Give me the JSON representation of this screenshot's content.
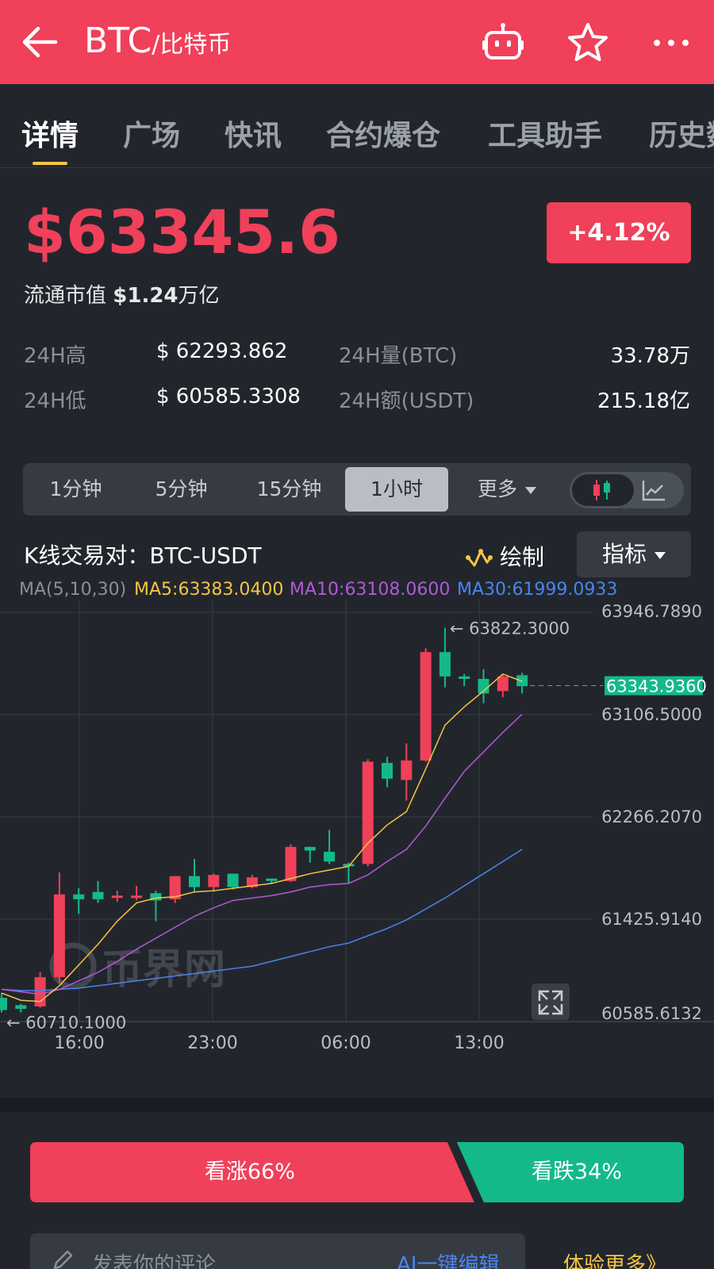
{
  "header": {
    "title_main": "BTC",
    "title_sub": "/比特币",
    "back_icon": "arrow-left-icon",
    "robot_icon": "robot-icon",
    "star_icon": "star-icon",
    "more_icon": "more-dots-icon",
    "bg_color": "#f0405a"
  },
  "tabs": [
    {
      "label": "详情",
      "active": true
    },
    {
      "label": "广场"
    },
    {
      "label": "快讯"
    },
    {
      "label": "合约爆仓"
    },
    {
      "label": "工具助手"
    },
    {
      "label": "历史数"
    }
  ],
  "price": {
    "value": "$63345.6",
    "change": "+4.12%",
    "market_cap_label": "流通市值",
    "market_cap_value": "$1.24",
    "market_cap_unit": "万亿"
  },
  "stats": {
    "high_label": "24H高",
    "high_value": "$ 62293.862",
    "low_label": "24H低",
    "low_value": "$ 60585.3308",
    "vol_label": "24H量(BTC)",
    "vol_value": "33.78万",
    "amt_label": "24H额(USDT)",
    "amt_value": "215.18亿"
  },
  "periods": [
    {
      "label": "1分钟"
    },
    {
      "label": "5分钟"
    },
    {
      "label": "15分钟"
    },
    {
      "label": "1小时",
      "active": true
    },
    {
      "label": "更多"
    }
  ],
  "toolbar": {
    "pair_label": "K线交易对：BTC-USDT",
    "draw_label": "绘制",
    "indicator_label": "指标"
  },
  "ma": {
    "label": "MA(5,10,30)",
    "ma5": "MA5:63383.0400",
    "ma10": "MA10:63108.0600",
    "ma30": "MA30:61999.0933",
    "colors": {
      "ma5": "#f5c443",
      "ma10": "#b05ad6",
      "ma30": "#4a84ef"
    }
  },
  "colors": {
    "up": "#f0405a",
    "down": "#14b98a"
  },
  "chart_data": {
    "type": "candlestick",
    "y_ticks": [
      "63946.7890",
      "63106.5000",
      "62266.2070",
      "61425.9140",
      "60585.6132"
    ],
    "ylim": [
      60585.6132,
      63946.789
    ],
    "x_ticks": [
      "16:00",
      "23:00",
      "06:00",
      "13:00"
    ],
    "current_price_label": "63343.9360",
    "current_price": 63343.936,
    "high_annotation": "← 63822.3000",
    "low_annotation": "← 60710.1000",
    "watermark": "币界网",
    "candles": [
      {
        "o": 60780,
        "h": 60820,
        "l": 60660,
        "c": 60680
      },
      {
        "o": 60720,
        "h": 60730,
        "l": 60660,
        "c": 60690
      },
      {
        "o": 60710,
        "h": 60990,
        "l": 60700,
        "c": 60950
      },
      {
        "o": 60950,
        "h": 61810,
        "l": 60900,
        "c": 61630
      },
      {
        "o": 61630,
        "h": 61680,
        "l": 61470,
        "c": 61590
      },
      {
        "o": 61650,
        "h": 61740,
        "l": 61560,
        "c": 61590
      },
      {
        "o": 61610,
        "h": 61660,
        "l": 61570,
        "c": 61620
      },
      {
        "o": 61610,
        "h": 61700,
        "l": 61580,
        "c": 61620
      },
      {
        "o": 61640,
        "h": 61660,
        "l": 61410,
        "c": 61580
      },
      {
        "o": 61590,
        "h": 61780,
        "l": 61560,
        "c": 61780
      },
      {
        "o": 61780,
        "h": 61920,
        "l": 61650,
        "c": 61690
      },
      {
        "o": 61690,
        "h": 61800,
        "l": 61650,
        "c": 61790
      },
      {
        "o": 61800,
        "h": 61800,
        "l": 61670,
        "c": 61690
      },
      {
        "o": 61690,
        "h": 61790,
        "l": 61680,
        "c": 61770
      },
      {
        "o": 61760,
        "h": 61740,
        "l": 61720,
        "c": 61740
      },
      {
        "o": 61740,
        "h": 62040,
        "l": 61730,
        "c": 62020
      },
      {
        "o": 62020,
        "h": 62020,
        "l": 61890,
        "c": 61990
      },
      {
        "o": 61980,
        "h": 62160,
        "l": 61880,
        "c": 61900
      },
      {
        "o": 61880,
        "h": 61890,
        "l": 61720,
        "c": 61860
      },
      {
        "o": 61880,
        "h": 62740,
        "l": 61860,
        "c": 62720
      },
      {
        "o": 62710,
        "h": 62760,
        "l": 62510,
        "c": 62580
      },
      {
        "o": 62570,
        "h": 62870,
        "l": 62400,
        "c": 62730
      },
      {
        "o": 62730,
        "h": 63650,
        "l": 62720,
        "c": 63620
      },
      {
        "o": 63620,
        "h": 63820,
        "l": 63330,
        "c": 63420
      },
      {
        "o": 63420,
        "h": 63440,
        "l": 63340,
        "c": 63400
      },
      {
        "o": 63400,
        "h": 63480,
        "l": 63200,
        "c": 63280
      },
      {
        "o": 63300,
        "h": 63440,
        "l": 63250,
        "c": 63420
      },
      {
        "o": 63430,
        "h": 63450,
        "l": 63280,
        "c": 63340
      }
    ],
    "ma5_values": [
      60820,
      60760,
      60750,
      60880,
      61050,
      61220,
      61410,
      61560,
      61600,
      61610,
      61650,
      61660,
      61680,
      61700,
      61720,
      61760,
      61800,
      61830,
      61860,
      62050,
      62200,
      62310,
      62660,
      63020,
      63170,
      63300,
      63440,
      63380
    ],
    "ma10_values": [
      60850,
      60830,
      60810,
      60850,
      60920,
      60990,
      61080,
      61180,
      61270,
      61360,
      61450,
      61520,
      61580,
      61600,
      61620,
      61650,
      61690,
      61710,
      61720,
      61790,
      61900,
      62000,
      62190,
      62420,
      62640,
      62800,
      62960,
      63110
    ],
    "ma30_values": [
      60850,
      60840,
      60840,
      60850,
      60860,
      60880,
      60900,
      60920,
      60940,
      60960,
      60980,
      61000,
      61020,
      61040,
      61080,
      61120,
      61160,
      61200,
      61230,
      61290,
      61350,
      61420,
      61510,
      61600,
      61700,
      61800,
      61900,
      62000
    ]
  },
  "sentiment": {
    "bull_label": "看涨66%",
    "bull_pct": 66,
    "bear_label": "看跌34%",
    "bear_pct": 34
  },
  "comment": {
    "placeholder": "发表你的评论",
    "ai_label": "AI一键编辑",
    "more_label": "体验更多》",
    "pencil_icon": "pencil-icon"
  }
}
